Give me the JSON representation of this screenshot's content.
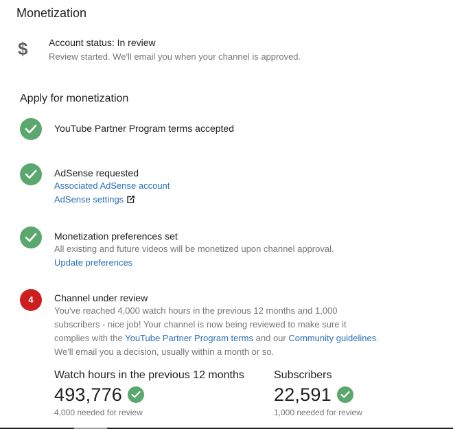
{
  "page": {
    "title": "Monetization"
  },
  "account": {
    "icon": "dollar-icon",
    "icon_glyph": "$",
    "status": "Account status: In review",
    "description": "Review started. We'll email you when your channel is approved."
  },
  "apply": {
    "title": "Apply for monetization",
    "steps": [
      {
        "state": "done",
        "title": "YouTube Partner Program terms accepted"
      },
      {
        "state": "done",
        "title": "AdSense requested",
        "links": [
          "Associated AdSense account",
          "AdSense settings"
        ]
      },
      {
        "state": "done",
        "title": "Monetization preferences set",
        "description": "All existing and future videos will be monetized upon channel approval.",
        "link": "Update preferences"
      },
      {
        "state": "current",
        "badge": "4",
        "title": "Channel under review",
        "desc_part1": "You've reached 4,000 watch hours in the previous 12 months and 1,000 subscribers - nice job! Your channel is now being reviewed to make sure it complies with the",
        "link_terms": "YouTube Partner Program terms",
        "desc_part2": "and our",
        "link_guidelines": "Community guidelines",
        "desc_part3": ". We'll email you a decision, usually within a month or so."
      }
    ]
  },
  "stats": {
    "watch_hours": {
      "label": "Watch hours in the previous 12 months",
      "value": "493,776",
      "note": "4,000 needed for review"
    },
    "subscribers": {
      "label": "Subscribers",
      "value": "22,591",
      "note": "1,000 needed for review"
    }
  },
  "colors": {
    "check_green": "#5aa86d",
    "review_red": "#cc1f1f",
    "link_blue": "#2a6fb5",
    "secondary_text": "#757575"
  }
}
